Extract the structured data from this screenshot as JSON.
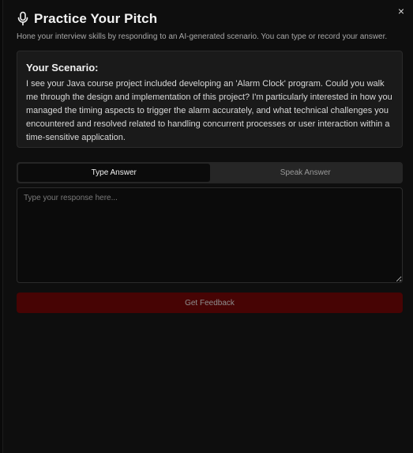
{
  "dialog": {
    "title": "Practice Your Pitch",
    "subtitle": "Hone your interview skills by responding to an AI-generated scenario. You can type or record your answer.",
    "close_label": "×"
  },
  "scenario": {
    "heading": "Your Scenario:",
    "text": "I see your Java course project included developing an 'Alarm Clock' program. Could you walk me through the design and implementation of this project? I'm particularly interested in how you managed the timing aspects to trigger the alarm accurately, and what technical challenges you encountered and resolved related to handling concurrent processes or user interaction within a time-sensitive application."
  },
  "tabs": [
    {
      "label": "Type Answer",
      "active": true
    },
    {
      "label": "Speak Answer",
      "active": false
    }
  ],
  "response": {
    "value": "",
    "placeholder": "Type your response here..."
  },
  "actions": {
    "feedback_label": "Get Feedback"
  },
  "colors": {
    "background": "#0e0e0e",
    "panel": "#1a1a1a",
    "accent_button": "#470404"
  },
  "icons": {
    "header": "microphone-icon",
    "close": "close-icon"
  }
}
